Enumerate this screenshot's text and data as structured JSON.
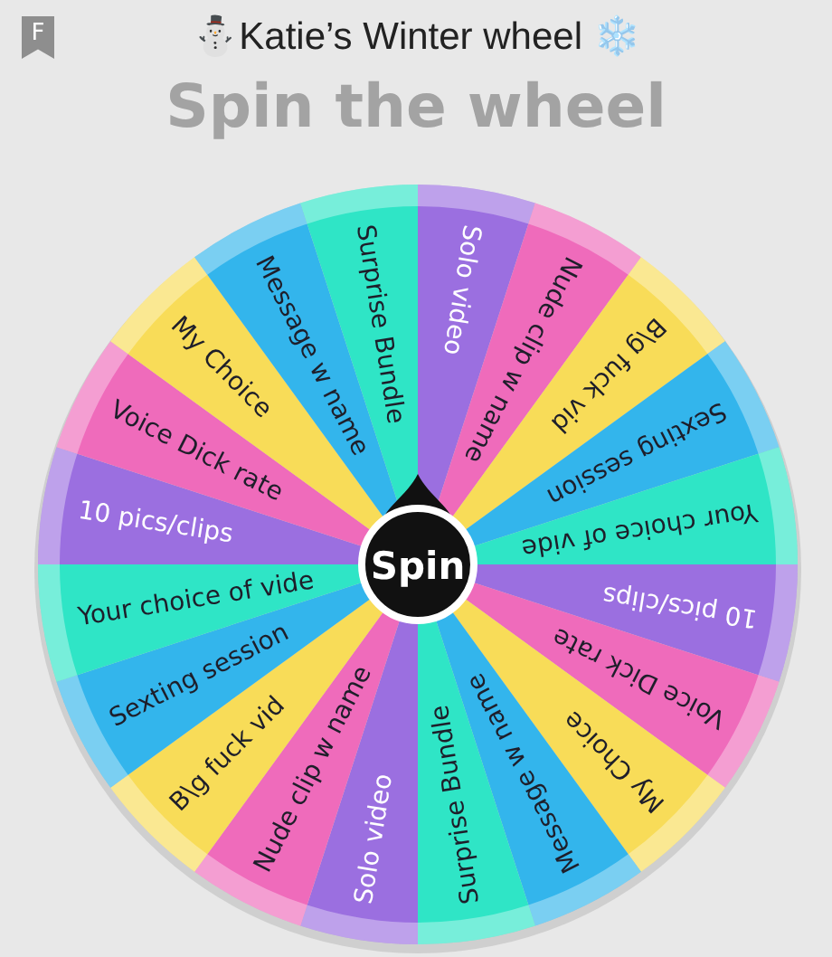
{
  "bookmark": {
    "label": "F"
  },
  "title": "⛄Katie’s Winter wheel ❄️",
  "heading": "Spin the wheel",
  "wheel": {
    "spin_button": "Spin",
    "segments": [
      {
        "label": "Solo video",
        "color": "#9b6fe0"
      },
      {
        "label": "Nude clip w name",
        "color": "#ef6bbb"
      },
      {
        "label": "B\\g fuck vid",
        "color": "#f8dc58"
      },
      {
        "label": "Sexting session",
        "color": "#33b5ec"
      },
      {
        "label": "Your choice of vide",
        "color": "#2fe5c6"
      },
      {
        "label": "10 pics/clips",
        "color": "#9b6fe0"
      },
      {
        "label": "Voice Dick rate",
        "color": "#ef6bbb"
      },
      {
        "label": "My Choice",
        "color": "#f8dc58"
      },
      {
        "label": "Message w name",
        "color": "#33b5ec"
      },
      {
        "label": "Surprise Bundle",
        "color": "#2fe5c6"
      },
      {
        "label": "Solo video",
        "color": "#9b6fe0"
      },
      {
        "label": "Nude clip w name",
        "color": "#ef6bbb"
      },
      {
        "label": "B\\g fuck vid",
        "color": "#f8dc58"
      },
      {
        "label": "Sexting session",
        "color": "#33b5ec"
      },
      {
        "label": "Your choice of vide",
        "color": "#2fe5c6"
      },
      {
        "label": "10 pics/clips",
        "color": "#9b6fe0"
      },
      {
        "label": "Voice Dick rate",
        "color": "#ef6bbb"
      },
      {
        "label": "My Choice",
        "color": "#f8dc58"
      },
      {
        "label": "Message w name",
        "color": "#33b5ec"
      },
      {
        "label": "Surprise Bundle",
        "color": "#2fe5c6"
      }
    ]
  }
}
